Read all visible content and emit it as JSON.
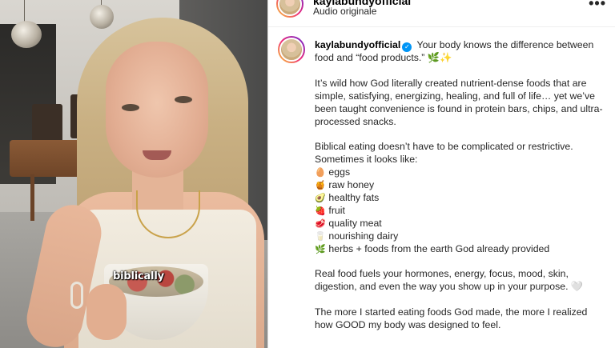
{
  "video": {
    "caption_word": "biblically"
  },
  "header": {
    "username": "kaylabundyofficial",
    "audio_label": "Audio originale",
    "more_label": "•••"
  },
  "post": {
    "username": "kaylabundyofficial",
    "verified_icon": "✓",
    "intro": "Your body knows the difference between food and “food products.” 🌿✨",
    "para1": "It’s wild how God literally created nutrient-dense foods that are simple, satisfying, energizing, healing, and full of life… yet we’ve been taught convenience is found in protein bars, chips, and ultra-processed snacks.",
    "list_intro_1": "Biblical eating doesn’t have to be complicated or restrictive.",
    "list_intro_2": "Sometimes it looks like:",
    "items": [
      {
        "emoji": "🥚",
        "icon": "egg-icon",
        "text": "eggs"
      },
      {
        "emoji": "🍯",
        "icon": "honey-icon",
        "text": "raw honey"
      },
      {
        "emoji": "🥑",
        "icon": "avocado-icon",
        "text": "healthy fats"
      },
      {
        "emoji": "🍓",
        "icon": "strawberry-icon",
        "text": "fruit"
      },
      {
        "emoji": "🥩",
        "icon": "meat-icon",
        "text": "quality meat"
      },
      {
        "emoji": "🥛",
        "icon": "milk-icon",
        "text": "nourishing dairy"
      },
      {
        "emoji": "🌿",
        "icon": "herb-icon",
        "text": "herbs + foods from the earth God already provided"
      }
    ],
    "para2": "Real food fuels your hormones, energy, focus, mood, skin, digestion, and even the way you show up in your purpose. 🤍",
    "para3": "The more I started eating foods God made, the more I realized how GOOD my body was designed to feel."
  },
  "colors": {
    "verified": "#0095f6",
    "text": "#262626",
    "avatar_ring_start": "#f9ce34",
    "avatar_ring_mid": "#ee2a7b",
    "avatar_ring_end": "#6228d7"
  }
}
